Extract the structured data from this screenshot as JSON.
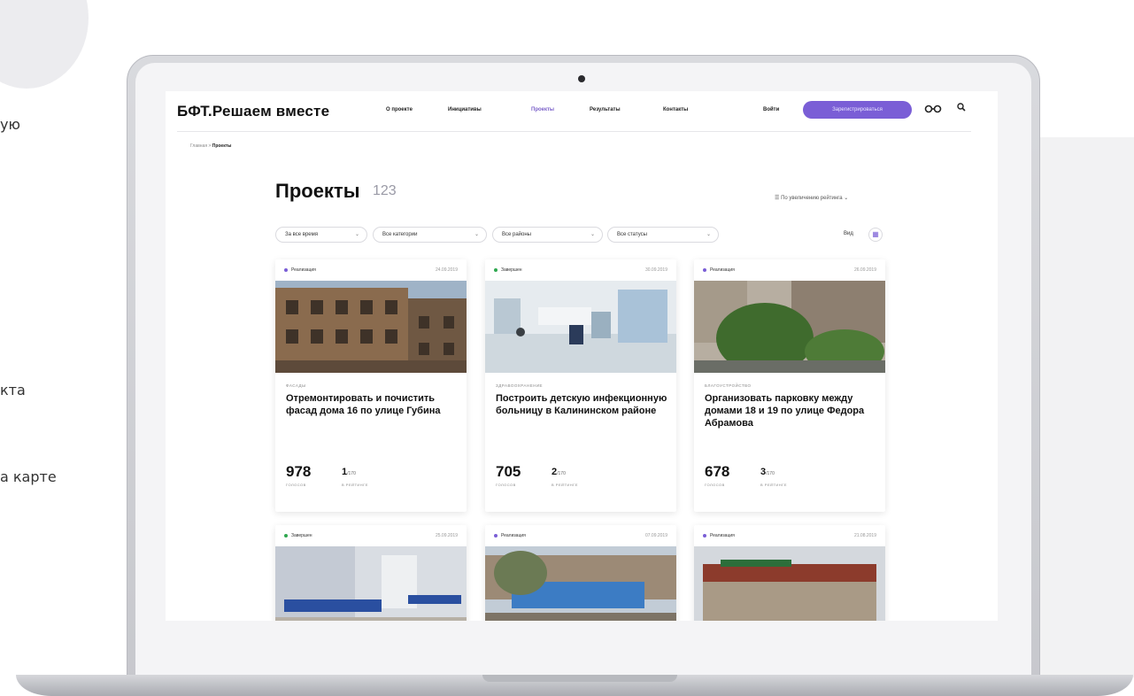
{
  "side_text": {
    "line1": "ую",
    "line2": "кта",
    "line3": "а карте"
  },
  "site": {
    "logo": "БФТ.Решаем вместе",
    "nav": [
      "О проекте",
      "Инициативы",
      "Проекты",
      "Результаты",
      "Контакты"
    ],
    "active_nav": "Проекты",
    "login": "Войти",
    "register": "Зарегистрироваться",
    "accent": "#7a5ed6"
  },
  "breadcrumb": {
    "home": "Главная",
    "separator": ">",
    "current": "Проекты"
  },
  "page": {
    "title": "Проекты",
    "count": "123",
    "sort_label": "По увеличению рейтинга"
  },
  "filters": [
    "За все время",
    "Все категории",
    "Все районы",
    "Все статусы"
  ],
  "view_label": "Вид",
  "cards": [
    {
      "status": "Реализация",
      "status_color": "#7a5ed6",
      "date": "24.09.2019",
      "category": "ФАСАДЫ",
      "title": "Отремонтировать и почистить фасад дома 16 по улице Губина",
      "votes": "978",
      "votes_label": "ГОЛОСОВ",
      "rank": "1",
      "rank_total": "/170",
      "rank_label": "В РЕЙТИНГЕ"
    },
    {
      "status": "Завершен",
      "status_color": "#2fa84f",
      "date": "30.09.2019",
      "category": "ЗДРАВООХРАНЕНИЕ",
      "title": "Построить детскую инфекционную больницу в Калининском районе",
      "votes": "705",
      "votes_label": "ГОЛОСОВ",
      "rank": "2",
      "rank_total": "/170",
      "rank_label": "В РЕЙТИНГЕ"
    },
    {
      "status": "Реализация",
      "status_color": "#7a5ed6",
      "date": "26.09.2019",
      "category": "БЛАГОУСТРОЙСТВО",
      "title": "Организовать парковку между домами 18 и 19 по улице Федора Абрамова",
      "votes": "678",
      "votes_label": "ГОЛОСОВ",
      "rank": "3",
      "rank_total": "/170",
      "rank_label": "В РЕЙТИНГЕ"
    },
    {
      "status": "Завершен",
      "status_color": "#2fa84f",
      "date": "25.09.2019"
    },
    {
      "status": "Реализация",
      "status_color": "#7a5ed6",
      "date": "07.09.2019"
    },
    {
      "status": "Реализация",
      "status_color": "#7a5ed6",
      "date": "21.08.2019"
    }
  ]
}
